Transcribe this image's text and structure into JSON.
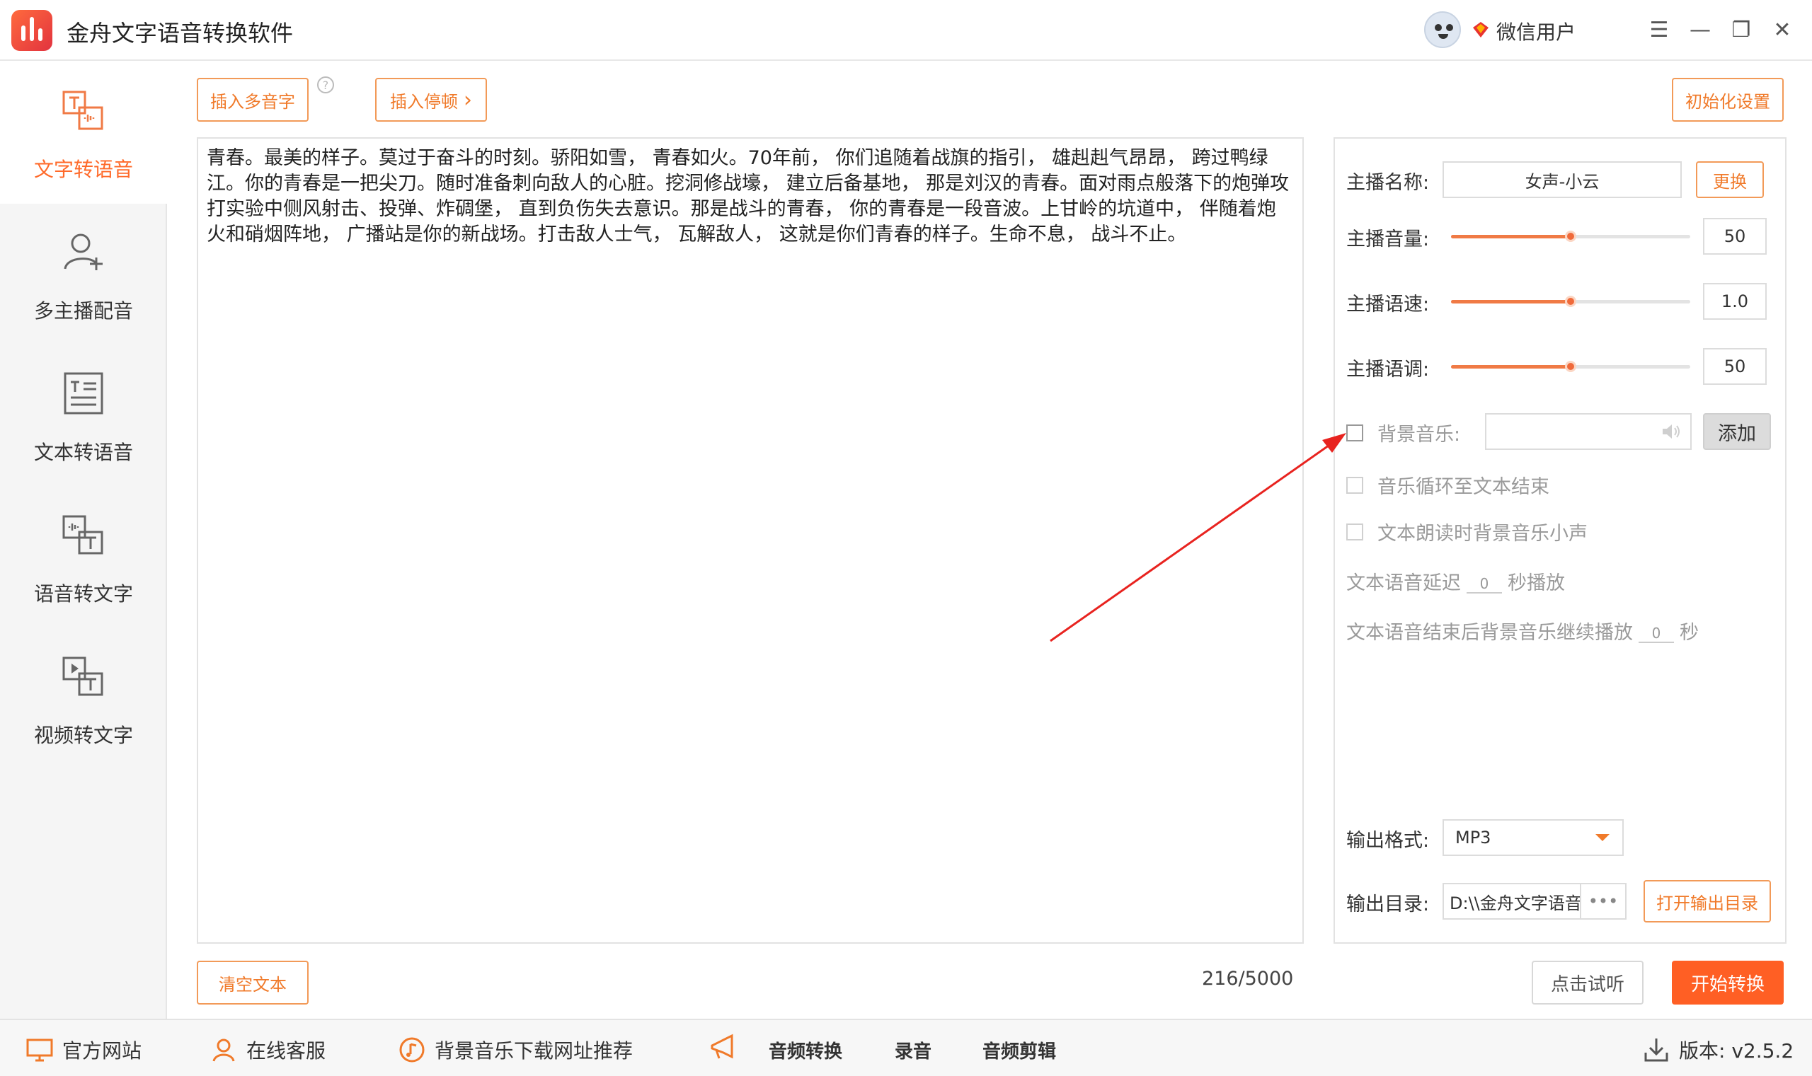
{
  "app": {
    "title": "金舟文字语音转换软件",
    "user_name": "微信用户"
  },
  "window_controls": {
    "menu": "☰",
    "minimize": "—",
    "restore": "❐",
    "close": "✕"
  },
  "sidebar": {
    "items": [
      {
        "label": "文字转语音",
        "active": true
      },
      {
        "label": "多主播配音",
        "active": false
      },
      {
        "label": "文本转语音",
        "active": false
      },
      {
        "label": "语音转文字",
        "active": false
      },
      {
        "label": "视频转文字",
        "active": false
      }
    ]
  },
  "toolbar": {
    "insert_polyphone": "插入多音字",
    "insert_pause": "插入停顿",
    "pause_chevron": "›",
    "help": "?",
    "reset_settings": "初始化设置"
  },
  "editor": {
    "text": "青春。最美的样子。莫过于奋斗的时刻。骄阳如雪， 青春如火。70年前， 你们追随着战旗的指引， 雄赳赳气昂昂， 跨过鸭绿江。你的青春是一把尖刀。随时准备刺向敌人的心脏。挖洞修战壕， 建立后备基地， 那是刘汉的青春。面对雨点般落下的炮弹攻打实验中侧风射击、投弹、炸碉堡， 直到负伤失去意识。那是战斗的青春， 你的青春是一段音波。上甘岭的坑道中， 伴随着炮火和硝烟阵地， 广播站是你的新战场。打击敌人士气， 瓦解敌人， 这就是你们青春的样子。生命不息， 战斗不止。",
    "clear_label": "清空文本",
    "char_count": "216/5000"
  },
  "panel": {
    "anchor_label": "主播名称:",
    "anchor_value": "女声-小云",
    "change_label": "更换",
    "volume_label": "主播音量:",
    "volume_value": "50",
    "volume_level": 0.5,
    "speed_label": "主播语速:",
    "speed_value": "1.0",
    "speed_level": 0.5,
    "pitch_label": "主播语调:",
    "pitch_value": "50",
    "pitch_level": 0.5,
    "bgm_label": "背景音乐:",
    "bgm_add": "添加",
    "loop_label": "音乐循环至文本结束",
    "duck_label": "文本朗读时背景音乐小声",
    "delay_prefix": "文本语音延迟",
    "delay_value": "0",
    "delay_suffix": "秒播放",
    "after_prefix": "文本语音结束后背景音乐继续播放",
    "after_value": "0",
    "after_suffix": "秒",
    "format_label": "输出格式:",
    "format_value": "MP3",
    "dir_label": "输出目录:",
    "dir_value": "D:\\\\金舟文字语音",
    "dir_more": "•••",
    "open_dir": "打开输出目录"
  },
  "actions": {
    "preview": "点击试听",
    "start": "开始转换"
  },
  "bottombar": {
    "website": "官方网站",
    "support": "在线客服",
    "bgm_sites": "背景音乐下载网址推荐",
    "audio_convert": "音频转换",
    "record": "录音",
    "audio_edit": "音频剪辑",
    "version": "版本: v2.5.2"
  },
  "colors": {
    "accent": "#ff6a2a",
    "primary": "#ff5f24",
    "arrow": "#e8231f"
  }
}
